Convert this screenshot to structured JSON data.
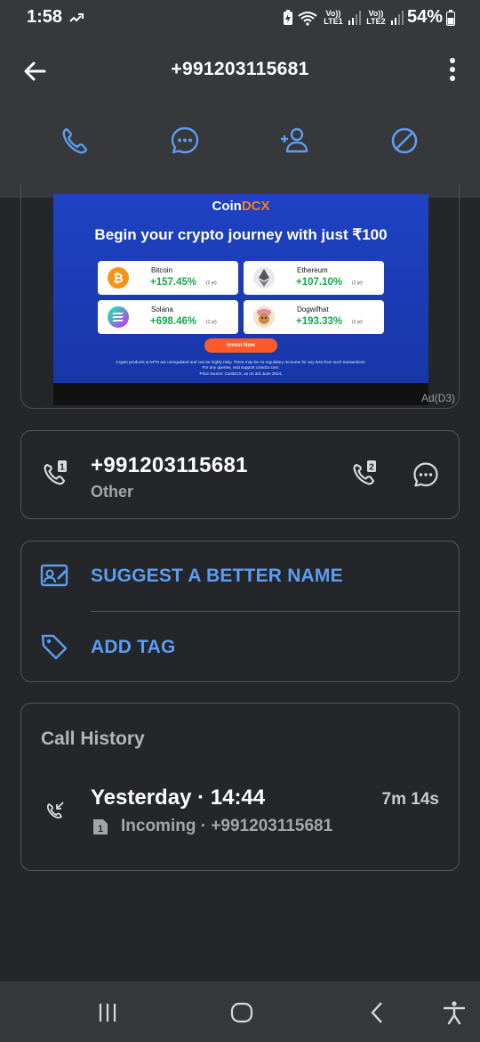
{
  "status_bar": {
    "time": "1:58",
    "network1": "Vo)) LTE1",
    "network2": "Vo)) LTE2",
    "battery_percent": "54%"
  },
  "header": {
    "title": "+991203115681",
    "icons": [
      "back-arrow-icon",
      "more-vertical-icon"
    ]
  },
  "actions": [
    "phone-icon",
    "message-icon",
    "add-contact-icon",
    "block-icon"
  ],
  "ad": {
    "brand_prefix": "Coin",
    "brand_suffix": "DCX",
    "headline": "Begin your crypto journey with just ₹100",
    "coins": [
      {
        "name": "Bitcoin",
        "change": "+157.45%",
        "period": "(1 yr)",
        "color": "#f7931a"
      },
      {
        "name": "Ethereum",
        "change": "+107.10%",
        "period": "(1 yr)",
        "color": "#8a8a8a"
      },
      {
        "name": "Solana",
        "change": "+698.46%",
        "period": "(1 yr)",
        "color": "#9945ff"
      },
      {
        "name": "Dogwifhat",
        "change": "+193.33%",
        "period": "(1 yr)",
        "color": "#c78a4a"
      }
    ],
    "cta": "Invest Now",
    "disclaimer_line1": "Crypto products & NFTs are unregulated and can be highly risky. There may be no regulatory recourse for any loss from such transactions.",
    "disclaimer_line2": "For any queries, visit support.coindcx.com.",
    "disclaimer_line3": "Price source: CoinDCX, as on 3rd June 2024.",
    "ad_label": "Ad(D3)"
  },
  "contact": {
    "number": "+991203115681",
    "label": "Other",
    "sim1_badge": "1",
    "sim2_badge": "2"
  },
  "options": {
    "suggest_label": "SUGGEST A BETTER NAME",
    "tag_label": "ADD TAG"
  },
  "history": {
    "title": "Call History",
    "entries": [
      {
        "when": "Yesterday · 14:44",
        "duration": "7m 14s",
        "detail": "Incoming · +991203115681",
        "sim": "1"
      }
    ]
  },
  "colors": {
    "accent": "#5b9df0",
    "background": "#252629",
    "header": "#37383b"
  }
}
